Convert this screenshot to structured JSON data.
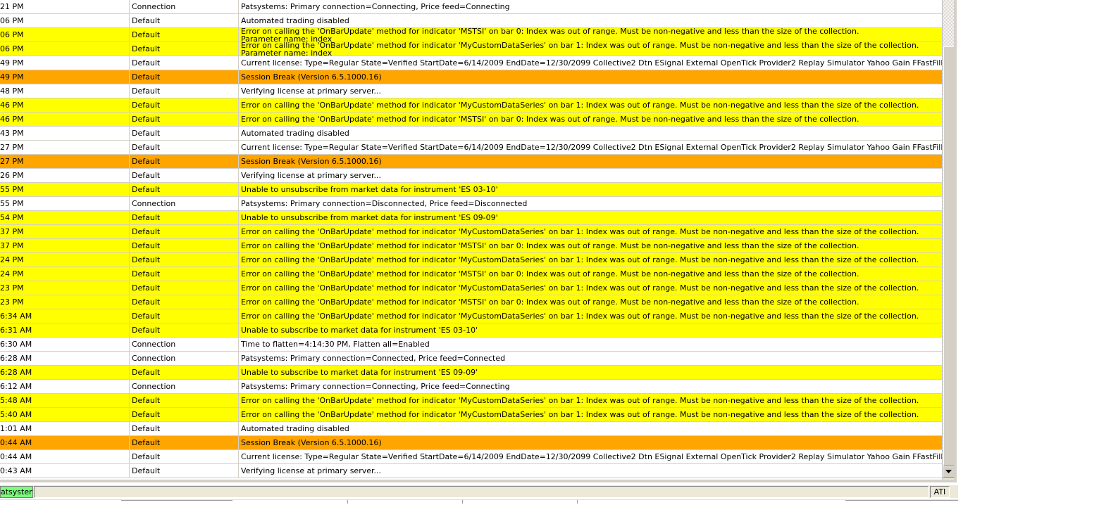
{
  "log": {
    "rows": [
      {
        "time": "21 PM",
        "category": "Connection",
        "message": "Patsystems: Primary connection=Connecting, Price feed=Connecting",
        "style": "cnn"
      },
      {
        "time": "06 PM",
        "category": "Default",
        "message": "Automated trading disabled",
        "style": "plain"
      },
      {
        "time": "06 PM",
        "category": "Default",
        "message": "Error on calling the 'OnBarUpdate' method for indicator 'MSTSI' on bar 0: Index was out of range. Must be non-negative and less than the size of the collection.",
        "message2": "Parameter name: index",
        "style": "warn"
      },
      {
        "time": "06 PM",
        "category": "Default",
        "message": "Error on calling the 'OnBarUpdate' method for indicator 'MyCustomDataSeries' on bar 1: Index was out of range. Must be non-negative and less than the size of the collection.",
        "message2": "Parameter name: index",
        "style": "warn"
      },
      {
        "time": "49 PM",
        "category": "Default",
        "message": "Current license: Type=Regular State=Verified StartDate=6/14/2009 EndDate=12/30/2099 Collective2 Dtn ESignal External OpenTick Provider2 Replay Simulator Yahoo Gain FFastFill Hosted Interac",
        "style": "plain"
      },
      {
        "time": "49 PM",
        "category": "Default",
        "message": "Session Break (Version 6.5.1000.16)",
        "style": "brk"
      },
      {
        "time": "48 PM",
        "category": "Default",
        "message": "Verifying license at primary server...",
        "style": "plain"
      },
      {
        "time": "46 PM",
        "category": "Default",
        "message": "Error on calling the 'OnBarUpdate' method for indicator 'MyCustomDataSeries' on bar 1: Index was out of range. Must be non-negative and less than the size of the collection.",
        "style": "warn"
      },
      {
        "time": "46 PM",
        "category": "Default",
        "message": "Error on calling the 'OnBarUpdate' method for indicator 'MSTSI' on bar 0: Index was out of range. Must be non-negative and less than the size of the collection.",
        "style": "warn"
      },
      {
        "time": "43 PM",
        "category": "Default",
        "message": "Automated trading disabled",
        "style": "plain"
      },
      {
        "time": "27 PM",
        "category": "Default",
        "message": "Current license: Type=Regular State=Verified StartDate=6/14/2009 EndDate=12/30/2099 Collective2 Dtn ESignal External OpenTick Provider2 Replay Simulator Yahoo Gain FFastFill Hosted Interac",
        "style": "plain"
      },
      {
        "time": "27 PM",
        "category": "Default",
        "message": "Session Break (Version 6.5.1000.16)",
        "style": "brk"
      },
      {
        "time": "26 PM",
        "category": "Default",
        "message": "Verifying license at primary server...",
        "style": "plain"
      },
      {
        "time": "55 PM",
        "category": "Default",
        "message": "Unable to unsubscribe from market data for instrument 'ES 03-10'",
        "style": "warn"
      },
      {
        "time": "55 PM",
        "category": "Connection",
        "message": "Patsystems: Primary connection=Disconnected, Price feed=Disconnected",
        "style": "cnn"
      },
      {
        "time": "54 PM",
        "category": "Default",
        "message": "Unable to unsubscribe from market data for instrument 'ES 09-09'",
        "style": "warn"
      },
      {
        "time": "37 PM",
        "category": "Default",
        "message": "Error on calling the 'OnBarUpdate' method for indicator 'MyCustomDataSeries' on bar 1: Index was out of range. Must be non-negative and less than the size of the collection.",
        "style": "warn"
      },
      {
        "time": "37 PM",
        "category": "Default",
        "message": "Error on calling the 'OnBarUpdate' method for indicator 'MSTSI' on bar 0: Index was out of range. Must be non-negative and less than the size of the collection.",
        "style": "warn"
      },
      {
        "time": "24 PM",
        "category": "Default",
        "message": "Error on calling the 'OnBarUpdate' method for indicator 'MyCustomDataSeries' on bar 1: Index was out of range. Must be non-negative and less than the size of the collection.",
        "style": "warn"
      },
      {
        "time": "24 PM",
        "category": "Default",
        "message": "Error on calling the 'OnBarUpdate' method for indicator 'MSTSI' on bar 0: Index was out of range. Must be non-negative and less than the size of the collection.",
        "style": "warn"
      },
      {
        "time": "23 PM",
        "category": "Default",
        "message": "Error on calling the 'OnBarUpdate' method for indicator 'MyCustomDataSeries' on bar 1: Index was out of range. Must be non-negative and less than the size of the collection.",
        "style": "warn"
      },
      {
        "time": "23 PM",
        "category": "Default",
        "message": "Error on calling the 'OnBarUpdate' method for indicator 'MSTSI' on bar 0: Index was out of range. Must be non-negative and less than the size of the collection.",
        "style": "warn"
      },
      {
        "time": "6:34 AM",
        "category": "Default",
        "message": "Error on calling the 'OnBarUpdate' method for indicator 'MyCustomDataSeries' on bar 1: Index was out of range. Must be non-negative and less than the size of the collection.",
        "style": "warn"
      },
      {
        "time": "6:31 AM",
        "category": "Default",
        "message": "Unable to subscribe to market data for instrument 'ES 03-10'",
        "style": "warn"
      },
      {
        "time": "6:30 AM",
        "category": "Connection",
        "message": "Time to flatten=4:14:30 PM, Flatten all=Enabled",
        "style": "cnn"
      },
      {
        "time": "6:28 AM",
        "category": "Connection",
        "message": "Patsystems: Primary connection=Connected, Price feed=Connected",
        "style": "cnn"
      },
      {
        "time": "6:28 AM",
        "category": "Default",
        "message": "Unable to subscribe to market data for instrument 'ES 09-09'",
        "style": "warn"
      },
      {
        "time": "6:12 AM",
        "category": "Connection",
        "message": "Patsystems: Primary connection=Connecting, Price feed=Connecting",
        "style": "cnn"
      },
      {
        "time": "5:48 AM",
        "category": "Default",
        "message": "Error on calling the 'OnBarUpdate' method for indicator 'MyCustomDataSeries' on bar 1: Index was out of range. Must be non-negative and less than the size of the collection.",
        "style": "warn"
      },
      {
        "time": "5:40 AM",
        "category": "Default",
        "message": "Error on calling the 'OnBarUpdate' method for indicator 'MyCustomDataSeries' on bar 1: Index was out of range. Must be non-negative and less than the size of the collection.",
        "style": "warn"
      },
      {
        "time": "1:01 AM",
        "category": "Default",
        "message": "Automated trading disabled",
        "style": "plain"
      },
      {
        "time": "0:44 AM",
        "category": "Default",
        "message": "Session Break (Version 6.5.1000.16)",
        "style": "brk"
      },
      {
        "time": "0:44 AM",
        "category": "Default",
        "message": "Current license: Type=Regular State=Verified StartDate=6/14/2009 EndDate=12/30/2099 Collective2 Dtn ESignal External OpenTick Provider2 Replay Simulator Yahoo Gain FFastFill Hosted Interac",
        "style": "plain"
      },
      {
        "time": "0:43 AM",
        "category": "Default",
        "message": "Verifying license at primary server...",
        "style": "plain"
      }
    ]
  },
  "status_bar": {
    "connection_label": "atsystems",
    "connection_color": "#7cfc7c",
    "ati_label": "ATI"
  },
  "colors": {
    "warning_row": "#ffff00",
    "session_break_row": "#ffa500",
    "normal_row": "#ffffff"
  },
  "icons": {
    "scroll_down": "triangle-down-icon"
  }
}
